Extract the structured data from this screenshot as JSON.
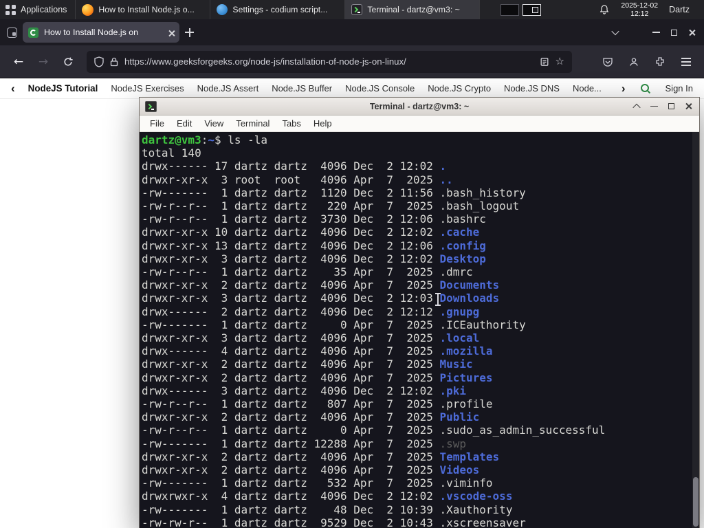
{
  "colors": {
    "term_bg": "#15151d",
    "term_fg": "#d8d8d4",
    "term_green": "#3fc43f",
    "term_blue": "#4d6bd8",
    "term_dim": "#5c5c5c",
    "gfg_green": "#2f8d46",
    "firefox_orange": "#ff9a1f",
    "codium_blue": "#3d8fd6"
  },
  "icons": {
    "back": "←",
    "forward": "→",
    "star": "☆"
  },
  "panel": {
    "applications": "Applications",
    "tasks": [
      {
        "label": "How to Install Node.js o...",
        "icon": "firefox"
      },
      {
        "label": "Settings - codium script...",
        "icon": "codium"
      },
      {
        "label": "Terminal - dartz@vm3: ~",
        "icon": "terminal"
      }
    ],
    "clock": {
      "date": "2025-12-02",
      "time": "12:12"
    },
    "user": "Dartz"
  },
  "browser": {
    "tab": {
      "title": "How to Install Node.js on"
    },
    "nav": {
      "url": "https://www.geeksforgeeks.org/node-js/installation-of-node-js-on-linux/"
    },
    "subnav": {
      "back": "‹",
      "active": "NodeJS Tutorial",
      "links": [
        "NodeJS Exercises",
        "Node.JS Assert",
        "Node.JS Buffer",
        "Node.JS Console",
        "Node.JS Crypto",
        "Node.JS DNS",
        "Node..."
      ],
      "forward": "›",
      "sign_in": "Sign In"
    }
  },
  "terminal": {
    "title": "Terminal - dartz@vm3: ~",
    "menu": [
      "File",
      "Edit",
      "View",
      "Terminal",
      "Tabs",
      "Help"
    ],
    "prompt": {
      "user_host": "dartz@vm3",
      "colon": ":",
      "path": "~",
      "dollar": "$ ",
      "command": "ls -la"
    },
    "total": "total 140",
    "listing": [
      {
        "meta": "drwx------ 17 dartz dartz  4096 Dec  2 12:02 ",
        "name": ".",
        "kind": "dir"
      },
      {
        "meta": "drwxr-xr-x  3 root  root   4096 Apr  7  2025 ",
        "name": "..",
        "kind": "dir"
      },
      {
        "meta": "-rw-------  1 dartz dartz  1120 Dec  2 11:56 ",
        "name": ".bash_history",
        "kind": "file"
      },
      {
        "meta": "-rw-r--r--  1 dartz dartz   220 Apr  7  2025 ",
        "name": ".bash_logout",
        "kind": "file"
      },
      {
        "meta": "-rw-r--r--  1 dartz dartz  3730 Dec  2 12:06 ",
        "name": ".bashrc",
        "kind": "file"
      },
      {
        "meta": "drwxr-xr-x 10 dartz dartz  4096 Dec  2 12:02 ",
        "name": ".cache",
        "kind": "dir"
      },
      {
        "meta": "drwxr-xr-x 13 dartz dartz  4096 Dec  2 12:06 ",
        "name": ".config",
        "kind": "dir"
      },
      {
        "meta": "drwxr-xr-x  3 dartz dartz  4096 Dec  2 12:02 ",
        "name": "Desktop",
        "kind": "dir"
      },
      {
        "meta": "-rw-r--r--  1 dartz dartz    35 Apr  7  2025 ",
        "name": ".dmrc",
        "kind": "file"
      },
      {
        "meta": "drwxr-xr-x  2 dartz dartz  4096 Apr  7  2025 ",
        "name": "Documents",
        "kind": "dir"
      },
      {
        "meta": "drwxr-xr-x  3 dartz dartz  4096 Dec  2 12:03 ",
        "name": "Downloads",
        "kind": "dir"
      },
      {
        "meta": "drwx------  2 dartz dartz  4096 Dec  2 12:12 ",
        "name": ".gnupg",
        "kind": "dir"
      },
      {
        "meta": "-rw-------  1 dartz dartz     0 Apr  7  2025 ",
        "name": ".ICEauthority",
        "kind": "file"
      },
      {
        "meta": "drwxr-xr-x  3 dartz dartz  4096 Apr  7  2025 ",
        "name": ".local",
        "kind": "dir"
      },
      {
        "meta": "drwx------  4 dartz dartz  4096 Apr  7  2025 ",
        "name": ".mozilla",
        "kind": "dir"
      },
      {
        "meta": "drwxr-xr-x  2 dartz dartz  4096 Apr  7  2025 ",
        "name": "Music",
        "kind": "dir"
      },
      {
        "meta": "drwxr-xr-x  2 dartz dartz  4096 Apr  7  2025 ",
        "name": "Pictures",
        "kind": "dir"
      },
      {
        "meta": "drwx------  3 dartz dartz  4096 Dec  2 12:02 ",
        "name": ".pki",
        "kind": "dir"
      },
      {
        "meta": "-rw-r--r--  1 dartz dartz   807 Apr  7  2025 ",
        "name": ".profile",
        "kind": "file"
      },
      {
        "meta": "drwxr-xr-x  2 dartz dartz  4096 Apr  7  2025 ",
        "name": "Public",
        "kind": "dir"
      },
      {
        "meta": "-rw-r--r--  1 dartz dartz     0 Apr  7  2025 ",
        "name": ".sudo_as_admin_successful",
        "kind": "file"
      },
      {
        "meta": "-rw-------  1 dartz dartz 12288 Apr  7  2025 ",
        "name": ".swp",
        "kind": "dim"
      },
      {
        "meta": "drwxr-xr-x  2 dartz dartz  4096 Apr  7  2025 ",
        "name": "Templates",
        "kind": "dir"
      },
      {
        "meta": "drwxr-xr-x  2 dartz dartz  4096 Apr  7  2025 ",
        "name": "Videos",
        "kind": "dir"
      },
      {
        "meta": "-rw-------  1 dartz dartz   532 Apr  7  2025 ",
        "name": ".viminfo",
        "kind": "file"
      },
      {
        "meta": "drwxrwxr-x  4 dartz dartz  4096 Dec  2 12:02 ",
        "name": ".vscode-oss",
        "kind": "dir"
      },
      {
        "meta": "-rw-------  1 dartz dartz    48 Dec  2 10:39 ",
        "name": ".Xauthority",
        "kind": "file"
      },
      {
        "meta": "-rw-rw-r--  1 dartz dartz  9529 Dec  2 10:43 ",
        "name": ".xscreensaver",
        "kind": "file"
      }
    ]
  }
}
